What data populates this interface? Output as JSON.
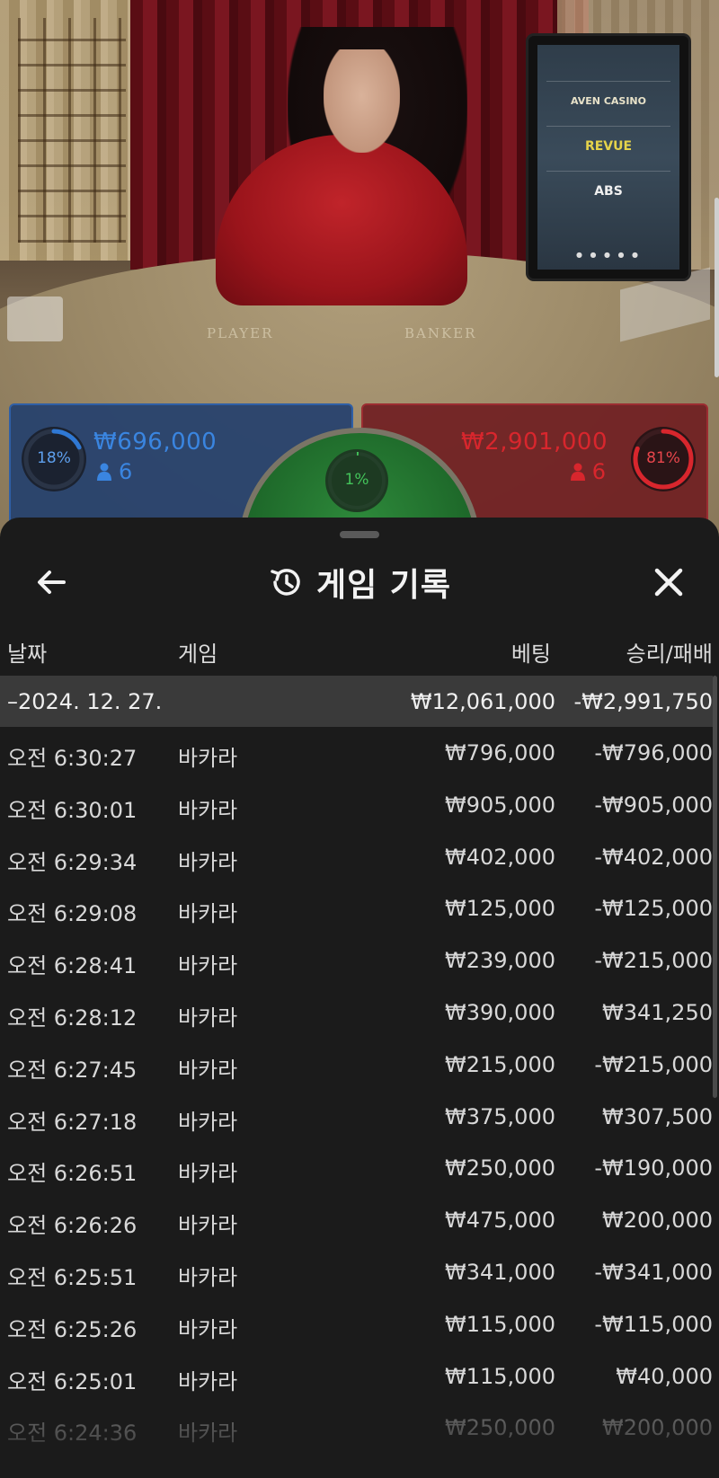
{
  "video": {
    "table_labels": {
      "player": "PLAYER",
      "banker": "BANKER"
    },
    "monitor_brands": [
      "AVEN CASINO",
      "REVUE",
      "ABS"
    ]
  },
  "bets": {
    "player": {
      "percent": "18%",
      "percent_value": 18,
      "amount": "₩696,000",
      "count": "6",
      "color": "#2f78d4"
    },
    "tie": {
      "percent": "1%",
      "percent_value": 1,
      "color": "#43c45a"
    },
    "banker": {
      "percent": "81%",
      "percent_value": 81,
      "amount": "₩2,901,000",
      "count": "6",
      "color": "#d8262d"
    }
  },
  "history": {
    "title": "게임 기록",
    "icons": {
      "back": "arrow-left-icon",
      "title": "history-icon",
      "close": "close-icon"
    },
    "columns": {
      "date": "날짜",
      "game": "게임",
      "bet": "베팅",
      "win_loss": "승리/패배"
    },
    "summary": {
      "date": "–2024. 12. 27.",
      "bet": "₩12,061,000",
      "win_loss": "-₩2,991,750"
    },
    "rows": [
      {
        "time": "오전 6:30:27",
        "game": "바카라",
        "bet": "₩796,000",
        "win_loss": "-₩796,000"
      },
      {
        "time": "오전 6:30:01",
        "game": "바카라",
        "bet": "₩905,000",
        "win_loss": "-₩905,000"
      },
      {
        "time": "오전 6:29:34",
        "game": "바카라",
        "bet": "₩402,000",
        "win_loss": "-₩402,000"
      },
      {
        "time": "오전 6:29:08",
        "game": "바카라",
        "bet": "₩125,000",
        "win_loss": "-₩125,000"
      },
      {
        "time": "오전 6:28:41",
        "game": "바카라",
        "bet": "₩239,000",
        "win_loss": "-₩215,000"
      },
      {
        "time": "오전 6:28:12",
        "game": "바카라",
        "bet": "₩390,000",
        "win_loss": "₩341,250"
      },
      {
        "time": "오전 6:27:45",
        "game": "바카라",
        "bet": "₩215,000",
        "win_loss": "-₩215,000"
      },
      {
        "time": "오전 6:27:18",
        "game": "바카라",
        "bet": "₩375,000",
        "win_loss": "₩307,500"
      },
      {
        "time": "오전 6:26:51",
        "game": "바카라",
        "bet": "₩250,000",
        "win_loss": "-₩190,000"
      },
      {
        "time": "오전 6:26:26",
        "game": "바카라",
        "bet": "₩475,000",
        "win_loss": "₩200,000"
      },
      {
        "time": "오전 6:25:51",
        "game": "바카라",
        "bet": "₩341,000",
        "win_loss": "-₩341,000"
      },
      {
        "time": "오전 6:25:26",
        "game": "바카라",
        "bet": "₩115,000",
        "win_loss": "-₩115,000"
      },
      {
        "time": "오전 6:25:01",
        "game": "바카라",
        "bet": "₩115,000",
        "win_loss": "₩40,000"
      },
      {
        "time": "오전 6:24:36",
        "game": "바카라",
        "bet": "₩250,000",
        "win_loss": "₩200,000"
      }
    ]
  }
}
